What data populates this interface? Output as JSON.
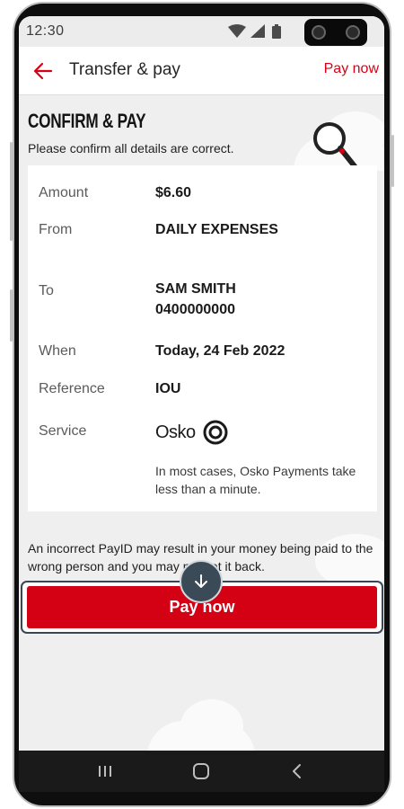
{
  "status_bar": {
    "time": "12:30",
    "icons": [
      "wifi-icon",
      "cellular-signal-icon",
      "battery-icon"
    ]
  },
  "app_bar": {
    "back_icon": "arrow-left-icon",
    "title": "Transfer & pay",
    "action_label": "Pay now"
  },
  "page": {
    "heading": "CONFIRM & PAY",
    "subheading": "Please confirm all details are correct."
  },
  "details": {
    "amount": {
      "label": "Amount",
      "value": "$6.60"
    },
    "from": {
      "label": "From",
      "value": "DAILY EXPENSES"
    },
    "to": {
      "label": "To",
      "name": "SAM SMITH",
      "number": "0400000000"
    },
    "when": {
      "label": "When",
      "value": "Today, 24 Feb 2022"
    },
    "reference": {
      "label": "Reference",
      "value": "IOU"
    },
    "service": {
      "label": "Service",
      "logo_text": "Osko",
      "note": "In most cases, Osko Payments take less than a minute."
    }
  },
  "warning": {
    "before": "An incorrect PayID may result in your money being paid to the wrong person and you ",
    "hidden_part": "may no",
    "after": "t get it back."
  },
  "pay_button": {
    "label": "Pay now"
  },
  "scroll_button": {
    "icon": "arrow-down-icon"
  },
  "nav_bar": {
    "icons": [
      "recent-apps-icon",
      "home-icon",
      "back-icon"
    ]
  },
  "colors": {
    "brand_red": "#d40013",
    "scroll_button": "#3b4a57",
    "background": "#efefef"
  }
}
